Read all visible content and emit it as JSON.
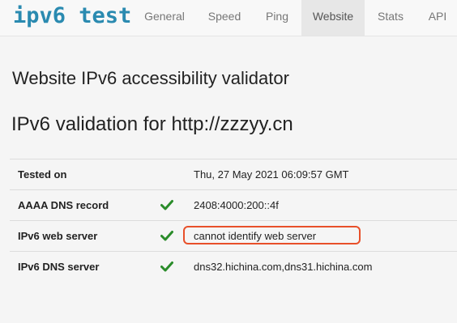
{
  "brand": "ipv6 test",
  "nav": {
    "items": [
      {
        "label": "General",
        "active": false
      },
      {
        "label": "Speed",
        "active": false
      },
      {
        "label": "Ping",
        "active": false
      },
      {
        "label": "Website",
        "active": true
      },
      {
        "label": "Stats",
        "active": false
      },
      {
        "label": "API",
        "active": false
      }
    ]
  },
  "page": {
    "heading": "Website IPv6 accessibility validator",
    "validation_heading": "IPv6 validation for http://zzzyy.cn"
  },
  "results": [
    {
      "label": "Tested on",
      "status": "",
      "value": "Thu, 27 May 2021 06:09:57 GMT"
    },
    {
      "label": "AAAA DNS record",
      "status": "check-icon",
      "value": "2408:4000:200::4f"
    },
    {
      "label": "IPv6 web server",
      "status": "check-icon",
      "value": "cannot identify web server"
    },
    {
      "label": "IPv6 DNS server",
      "status": "check-icon",
      "value": "dns32.hichina.com,dns31.hichina.com"
    }
  ],
  "colors": {
    "brand": "#2a8ab0",
    "check": "#2a8c2a",
    "highlight_border": "#e8502a"
  }
}
